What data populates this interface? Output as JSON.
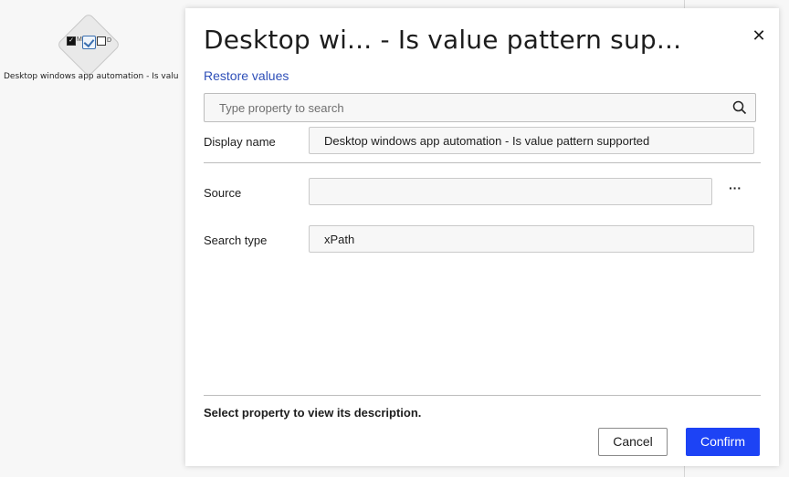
{
  "canvas": {
    "node": {
      "label": "Desktop windows app automation - Is valu...",
      "icon_letters": [
        "M",
        "D"
      ]
    }
  },
  "dialog": {
    "title": "Desktop wi... - Is value pattern sup...",
    "restore_label": "Restore values",
    "search": {
      "placeholder": "Type property to search",
      "value": ""
    },
    "fields": {
      "display_name": {
        "label": "Display name",
        "value": "Desktop windows app automation - Is value pattern supported"
      },
      "source": {
        "label": "Source",
        "value": ""
      },
      "search_type": {
        "label": "Search type",
        "value": "xPath"
      }
    },
    "more_label": "···",
    "description": "Select property to view its description.",
    "buttons": {
      "cancel": "Cancel",
      "confirm": "Confirm"
    },
    "close_icon": "close-icon"
  },
  "colors": {
    "link": "#2e4fb8",
    "primary": "#1d43f5",
    "canvas_bg": "#f7f7f7"
  }
}
